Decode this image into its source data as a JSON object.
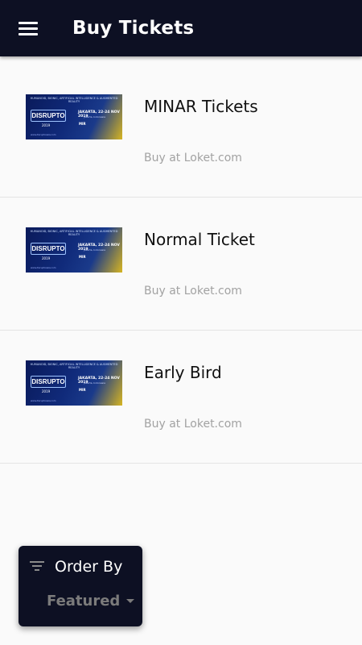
{
  "app_bar": {
    "title": "Buy Tickets",
    "menu_icon": "menu-icon"
  },
  "tickets": [
    {
      "name": "MINAR Tickets",
      "source": "Buy at Loket.com"
    },
    {
      "name": "Normal Ticket",
      "source": "Buy at Loket.com"
    },
    {
      "name": "Early Bird",
      "source": "Buy at Loket.com"
    }
  ],
  "banner": {
    "headline": "HUMANOID, BIONIC, ARTIFICIAL INTELLIGENCE & AUGMENTED REALITY",
    "logo": "DISRUPTO",
    "year": "2019",
    "date": "JAKARTA, 22-24 NOV 2019",
    "city": "Jakarta, Indonesia",
    "sponsor": "MIR",
    "footer": "www.disruptoasia.com"
  },
  "order_by": {
    "label": "Order By",
    "selected": "Featured",
    "icon": "filter-icon"
  },
  "colors": {
    "app_bar": "#0d1023",
    "background": "#fafafa",
    "title_text": "#ffffff",
    "item_name": "#111111",
    "item_source": "#a2a2a2"
  }
}
